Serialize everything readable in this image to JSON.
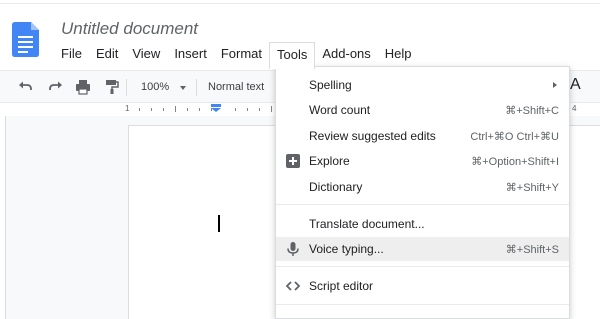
{
  "app": {
    "title": "Untitled document",
    "brand_color": "#4285f4"
  },
  "menubar": {
    "items": [
      {
        "label": "File"
      },
      {
        "label": "Edit"
      },
      {
        "label": "View"
      },
      {
        "label": "Insert"
      },
      {
        "label": "Format"
      },
      {
        "label": "Tools"
      },
      {
        "label": "Add-ons"
      },
      {
        "label": "Help"
      }
    ],
    "open_menu": "Tools"
  },
  "toolbar": {
    "undo_icon": "undo-icon",
    "redo_icon": "redo-icon",
    "print_icon": "print-icon",
    "paint_format_icon": "paint-format-icon",
    "zoom": "100%",
    "style": "Normal text",
    "peek_glyph": "A"
  },
  "ruler": {
    "left_number": "1",
    "right_number": "4"
  },
  "tools_menu": {
    "items": [
      {
        "label": "Spelling",
        "shortcut": "",
        "has_submenu": true,
        "icon": ""
      },
      {
        "label": "Word count",
        "shortcut": "⌘+Shift+C",
        "icon": ""
      },
      {
        "label": "Review suggested edits",
        "shortcut": "Ctrl+⌘O Ctrl+⌘U",
        "icon": ""
      },
      {
        "label": "Explore",
        "shortcut": "⌘+Option+Shift+I",
        "icon": "explore-icon"
      },
      {
        "label": "Dictionary",
        "shortcut": "⌘+Shift+Y",
        "icon": ""
      },
      {
        "label": "Translate document...",
        "shortcut": "",
        "icon": ""
      },
      {
        "label": "Voice typing...",
        "shortcut": "⌘+Shift+S",
        "icon": "microphone-icon",
        "highlighted": true
      },
      {
        "label": "Script editor",
        "shortcut": "",
        "icon": "code-icon"
      }
    ]
  }
}
